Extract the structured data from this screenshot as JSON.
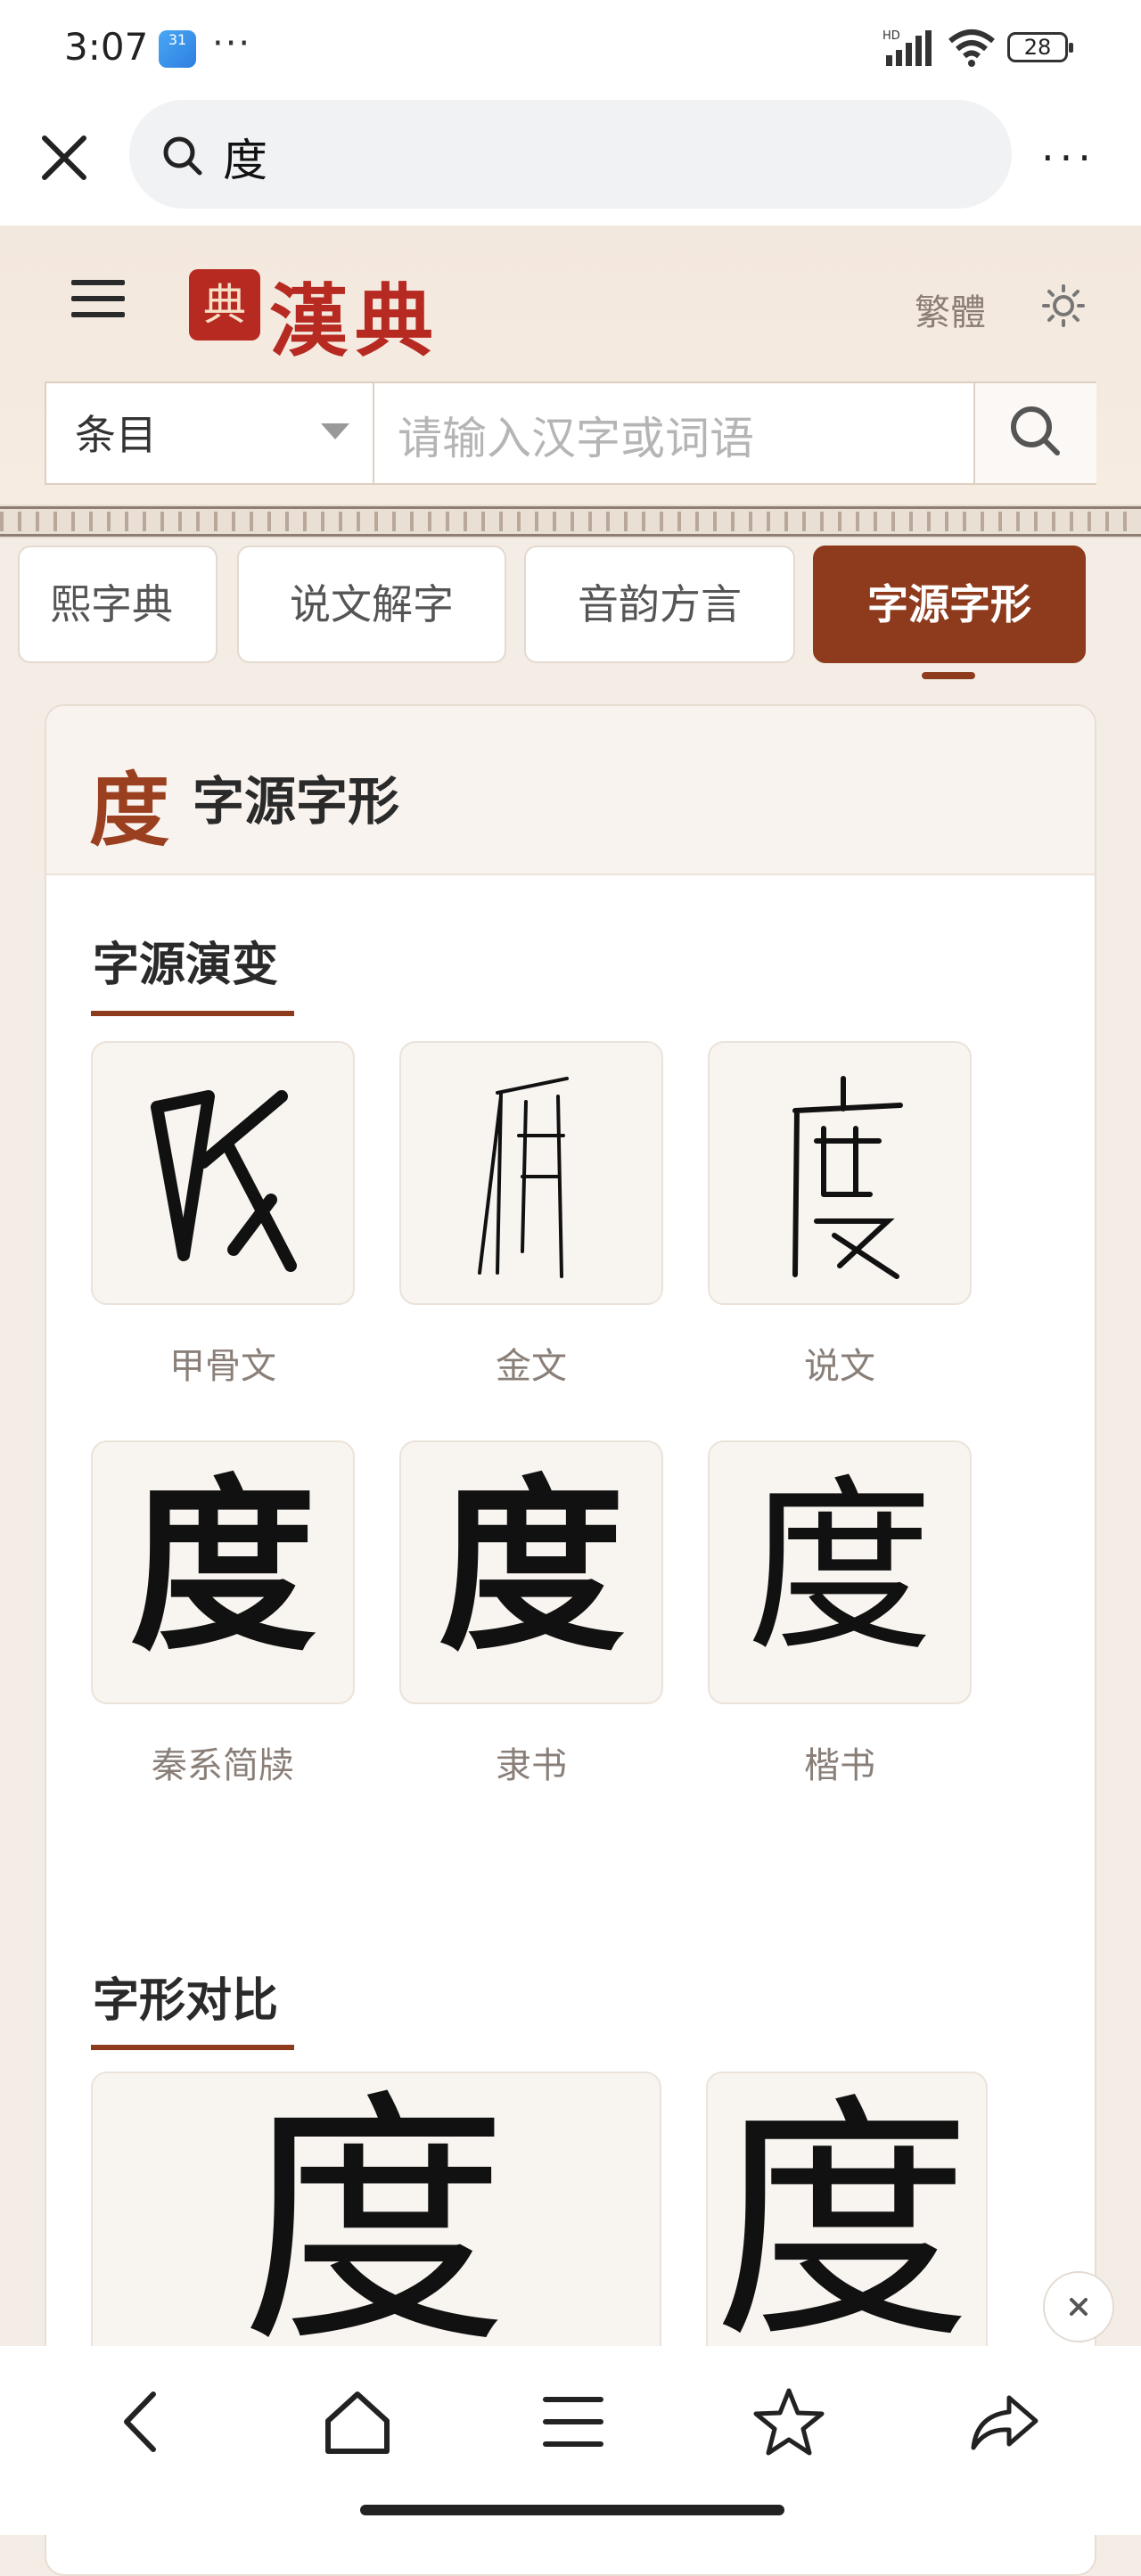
{
  "status_bar": {
    "time": "3:07",
    "calendar_badge": "31",
    "more": "···",
    "network": "HD",
    "battery": "28"
  },
  "browser": {
    "query": "度",
    "more": "···"
  },
  "site": {
    "logo_seal": "典",
    "logo_text": "漢典",
    "traditional_toggle": "繁體",
    "search": {
      "category": "条目",
      "placeholder": "请输入汉字或词语"
    }
  },
  "tabs": [
    {
      "label": "熙字典",
      "active": false
    },
    {
      "label": "说文解字",
      "active": false
    },
    {
      "label": "音韵方言",
      "active": false
    },
    {
      "label": "字源字形",
      "active": true
    }
  ],
  "card": {
    "character": "度",
    "title": "字源字形",
    "evolution": {
      "title": "字源演变",
      "items": [
        {
          "glyph": "度",
          "label": "甲骨文"
        },
        {
          "glyph": "度",
          "label": "金文"
        },
        {
          "glyph": "度",
          "label": "说文"
        },
        {
          "glyph": "度",
          "label": "秦系简牍"
        },
        {
          "glyph": "度",
          "label": "隶书"
        },
        {
          "glyph": "度",
          "label": "楷书"
        }
      ]
    },
    "comparison": {
      "title": "字形对比",
      "glyphs": [
        "度",
        "度"
      ]
    }
  },
  "colors": {
    "accent": "#8e3a1c",
    "brand_red": "#b72a22",
    "page_bg": "#f4ede6"
  }
}
